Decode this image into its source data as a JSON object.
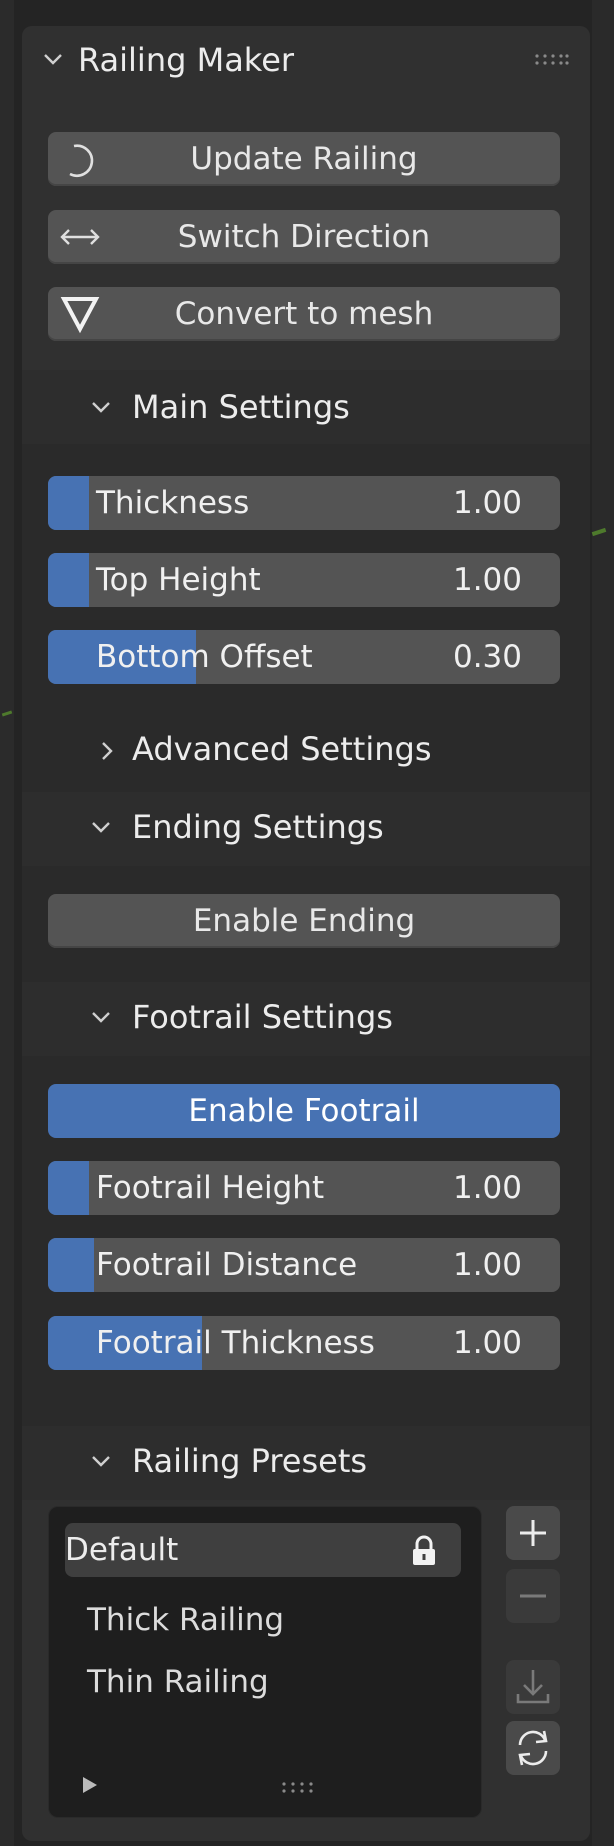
{
  "panel": {
    "title": "Railing Maker",
    "buttons": {
      "update": "Update Railing",
      "switch": "Switch Direction",
      "convert": "Convert to mesh"
    }
  },
  "main_settings": {
    "title": "Main Settings",
    "fields": [
      {
        "label": "Thickness",
        "value": "1.00",
        "fill": 0.08
      },
      {
        "label": "Top Height",
        "value": "1.00",
        "fill": 0.08
      },
      {
        "label": "Bottom Offset",
        "value": "0.30",
        "fill": 0.29
      }
    ],
    "advanced": "Advanced Settings"
  },
  "ending_settings": {
    "title": "Ending Settings",
    "enable_label": "Enable Ending"
  },
  "footrail_settings": {
    "title": "Footrail Settings",
    "enable_label": "Enable Footrail",
    "fields": [
      {
        "label": "Footrail Height",
        "value": "1.00",
        "fill": 0.08
      },
      {
        "label": "Footrail Distance",
        "value": "1.00",
        "fill": 0.09
      },
      {
        "label": "Footrail Thickness",
        "value": "1.00",
        "fill": 0.3
      }
    ]
  },
  "presets": {
    "title": "Railing Presets",
    "items": [
      "Default",
      "Thick Railing",
      "Thin Railing"
    ],
    "selected": "Default"
  },
  "colors": {
    "panel_bg": "#303030",
    "button_bg": "#545454",
    "accent": "#4772b3"
  },
  "icons": [
    "chevron-down-icon",
    "chevron-right-icon",
    "drag-grip-icon",
    "refresh-arc-icon",
    "double-arrow-icon",
    "triangle-down-icon",
    "lock-icon",
    "plus-icon",
    "minus-icon",
    "download-icon",
    "reload-icon",
    "play-icon"
  ]
}
